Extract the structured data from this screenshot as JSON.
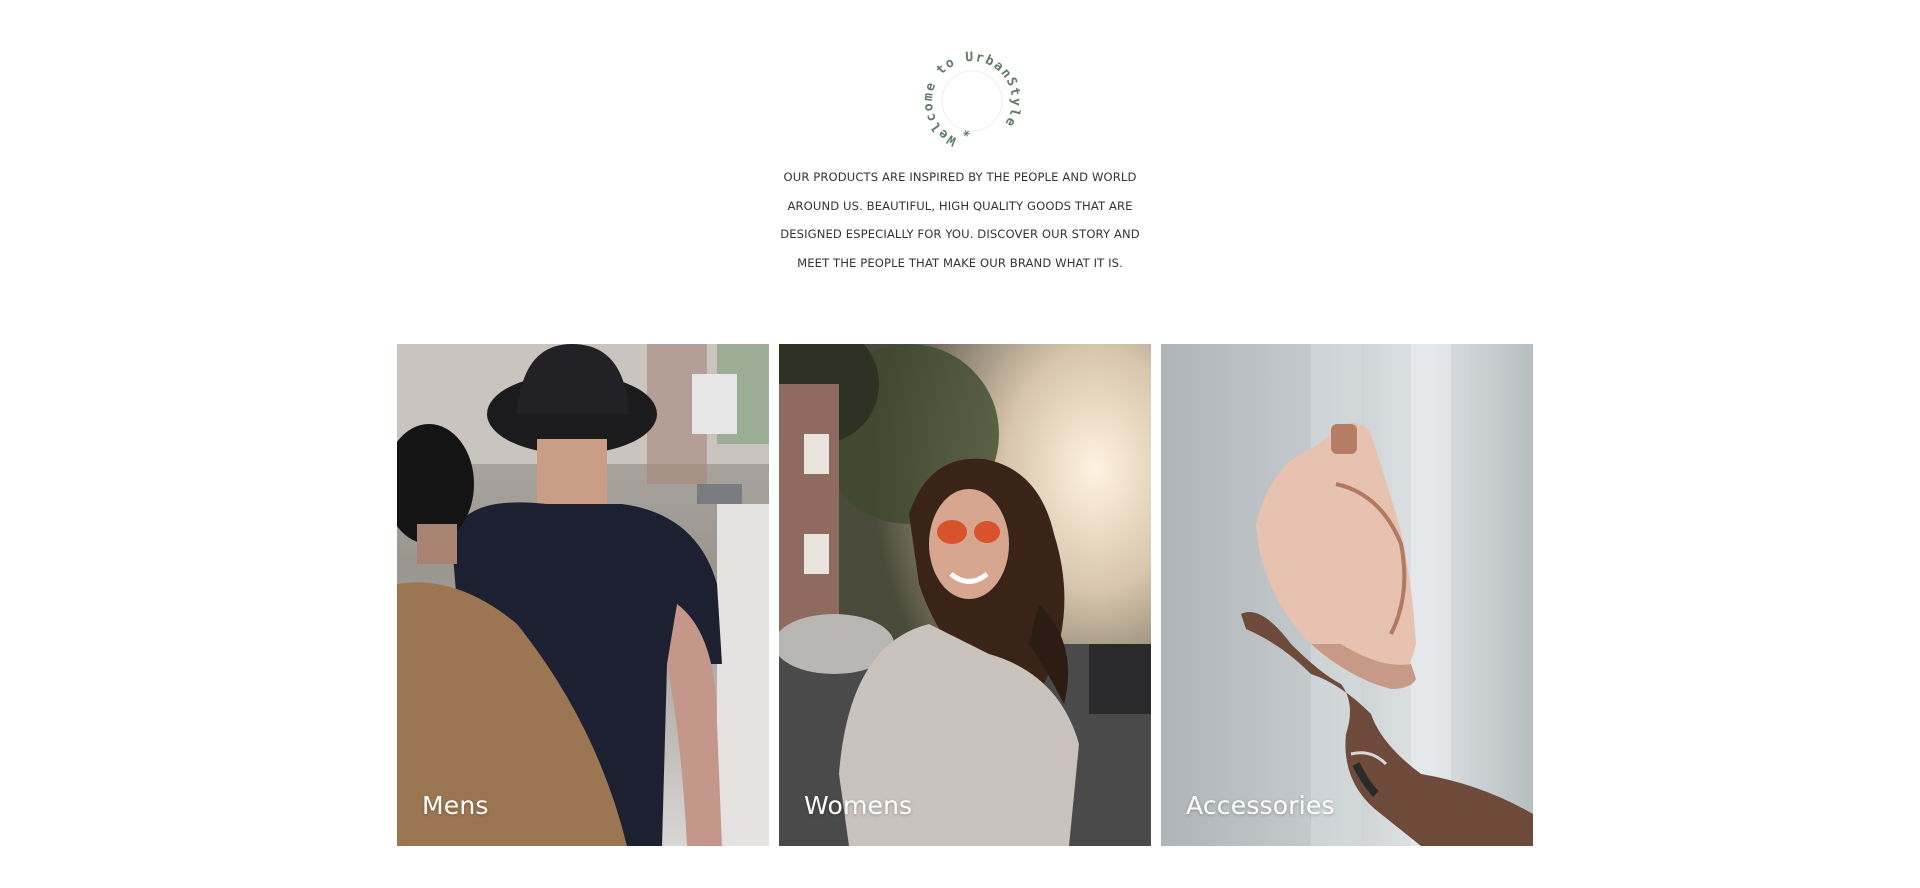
{
  "badge": {
    "text": "Welcome to UrbanStyle",
    "star": "*"
  },
  "intro": {
    "lines": [
      "OUR PRODUCTS ARE INSPIRED BY THE PEOPLE AND WORLD",
      "AROUND US. BEAUTIFUL, HIGH QUALITY GOODS THAT ARE",
      "DESIGNED ESPECIALLY FOR YOU. DISCOVER OUR STORY AND",
      "MEET THE PEOPLE THAT MAKE OUR BRAND WHAT IT IS."
    ]
  },
  "categories": [
    {
      "label": "Mens"
    },
    {
      "label": "Womens"
    },
    {
      "label": "Accessories"
    }
  ],
  "colors": {
    "badge_text": "#5d7a63",
    "intro_text": "#333333",
    "card_label": "#ffffff"
  }
}
